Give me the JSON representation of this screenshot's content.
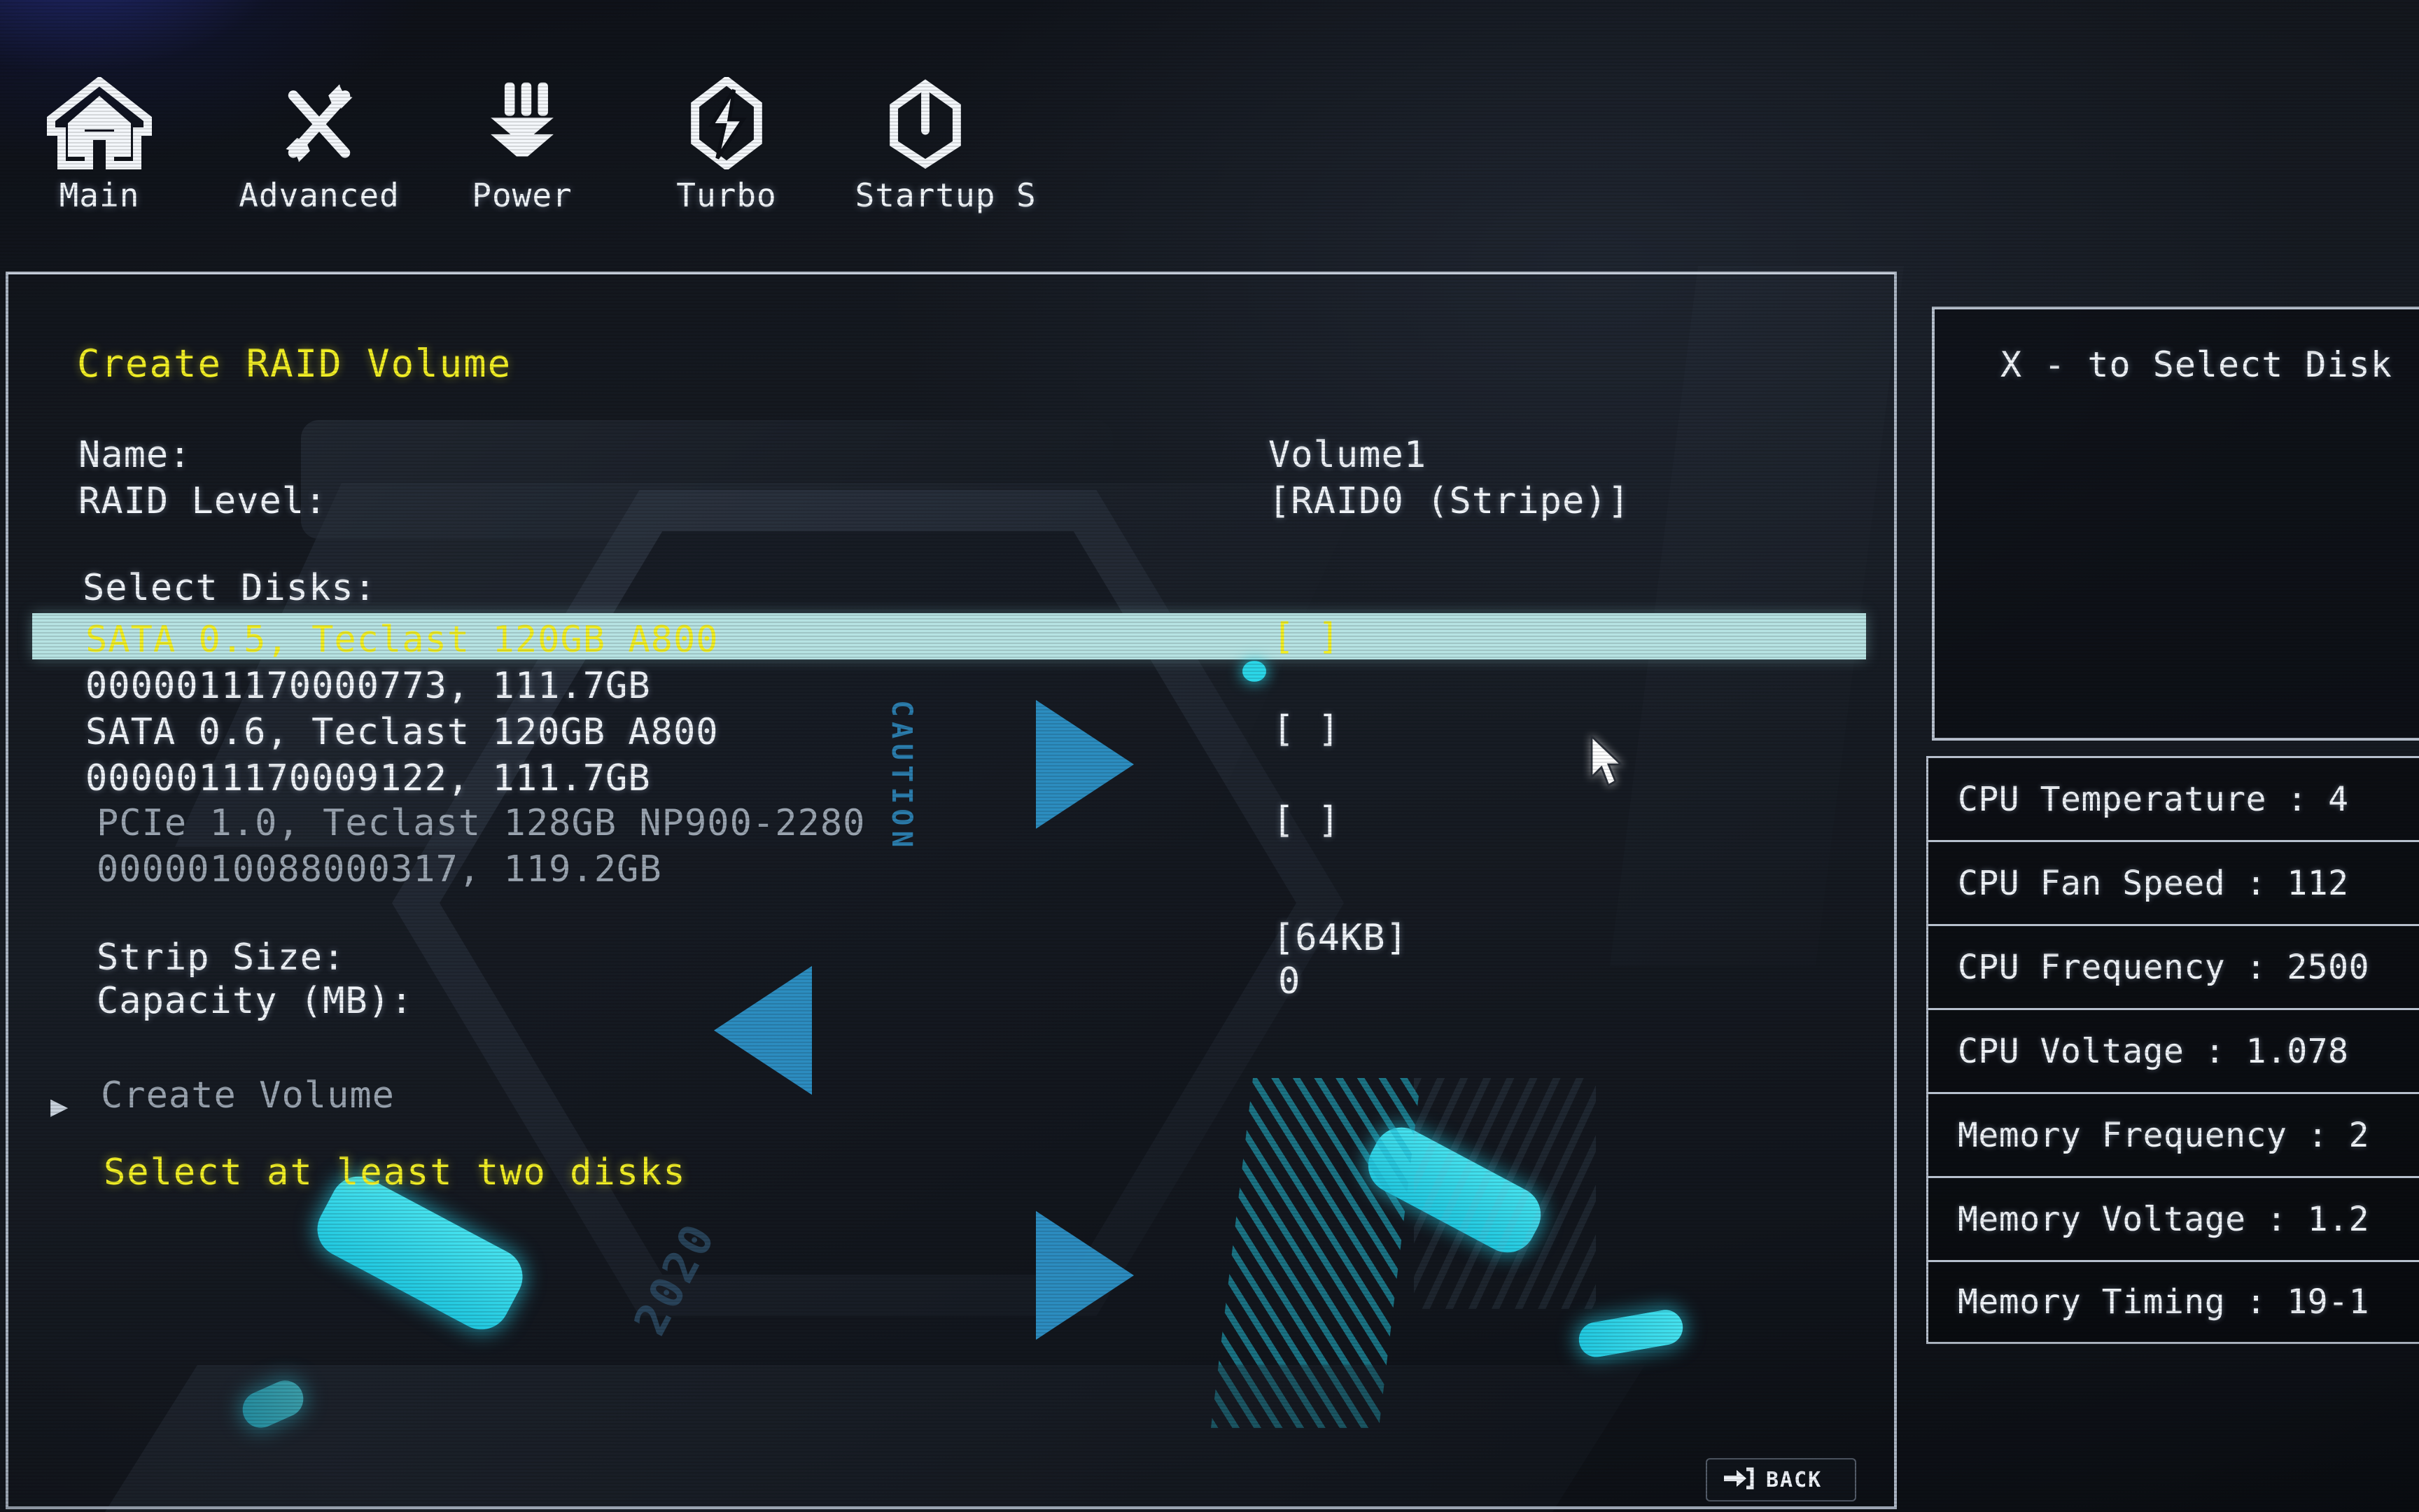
{
  "nav": {
    "items": [
      {
        "label": "Main",
        "icon": "home-icon"
      },
      {
        "label": "Advanced",
        "icon": "tools-icon"
      },
      {
        "label": "Power",
        "icon": "layers-icon"
      },
      {
        "label": "Turbo",
        "icon": "lightning-icon"
      },
      {
        "label": "Startup",
        "icon": "power-icon"
      },
      {
        "label": "S",
        "icon": "save-icon"
      }
    ]
  },
  "panel": {
    "title": "Create RAID Volume",
    "fields": {
      "name_label": "Name:",
      "name_value": "Volume1",
      "raid_level_label": "RAID Level:",
      "raid_level_value": "[RAID0 (Stripe)]",
      "select_disks_label": "Select Disks:",
      "strip_size_label": "Strip Size:",
      "strip_size_value": "[64KB]",
      "capacity_label": "Capacity (MB):",
      "capacity_value": "0"
    },
    "disks": [
      {
        "line1": "SATA 0.5, Teclast 120GB A800",
        "line2": "0000011170000773, 111.7GB",
        "checkbox": "[ ]",
        "selected": true,
        "disabled": false
      },
      {
        "line1": "SATA 0.6, Teclast 120GB A800",
        "line2": "0000011170009122, 111.7GB",
        "checkbox": "[ ]",
        "selected": false,
        "disabled": false
      },
      {
        "line1": "PCIe 1.0, Teclast 128GB NP900-2280",
        "line2": "0000010088000317, 119.2GB",
        "checkbox": "[ ]",
        "selected": false,
        "disabled": true
      }
    ],
    "create_volume_label": "Create Volume",
    "create_volume_marker": "▶",
    "warning": "Select at least two disks"
  },
  "help": {
    "text": "X - to Select Disk"
  },
  "hardware_monitor": {
    "rows": [
      "CPU Temperature : 4",
      "CPU Fan Speed : 112",
      "CPU Frequency : 2500",
      "CPU Voltage : 1.078",
      "Memory Frequency : 2",
      "Memory Voltage : 1.2",
      "Memory Timing : 19-1"
    ]
  },
  "footer": {
    "back_label": "BACK",
    "back_icon": "back-arrow-icon"
  },
  "background": {
    "caution_text": "CAUTION",
    "year_text": "2020"
  },
  "colors": {
    "highlight_bg": "#b7e3e3",
    "highlight_text": "#f2ef26",
    "accent_yellow": "#f2ef26",
    "accent_blue": "#2f97ce",
    "body_text": "#f0f4f9",
    "dim_text": "#9aa4b0",
    "panel_border": "#b7c0cd"
  }
}
